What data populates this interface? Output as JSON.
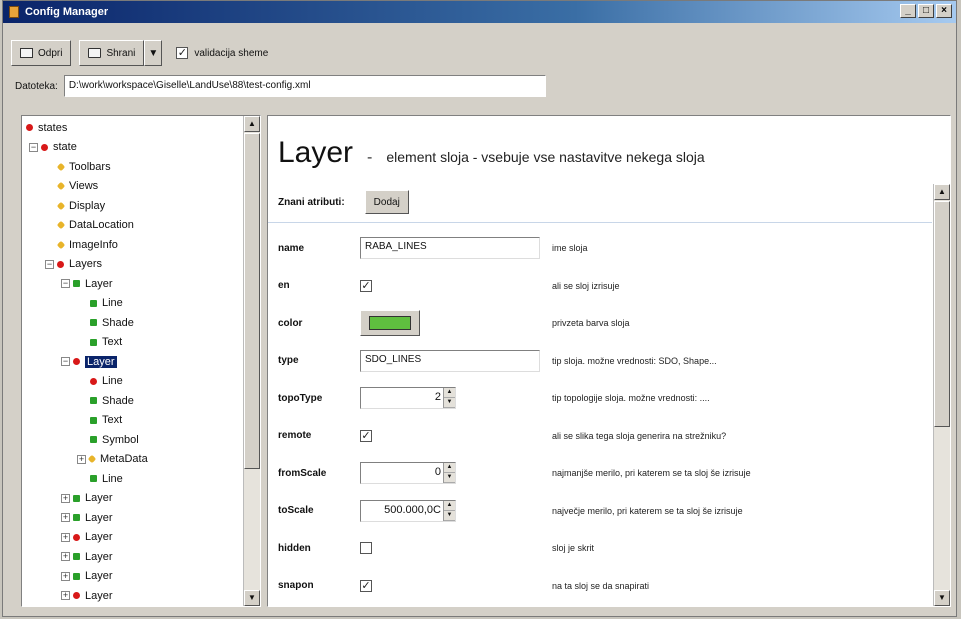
{
  "window": {
    "title": "Config Manager",
    "controls": [
      "_",
      "□",
      "×"
    ]
  },
  "toolbar": {
    "open_label": "Odpri",
    "save_label": "Shrani",
    "save_dropdown": "▼",
    "validation_label": "validacija sheme",
    "validation_checked": "✓"
  },
  "file": {
    "label": "Datoteka:",
    "path": "D:\\work\\workspace\\Giselle\\LandUse\\88\\test-config.xml"
  },
  "tree": {
    "items": [
      {
        "label": "states",
        "icon": "red",
        "level": 0,
        "expander": ""
      },
      {
        "label": "state",
        "icon": "red",
        "level": 1,
        "expander": "−"
      },
      {
        "label": "Toolbars",
        "icon": "yellow",
        "level": 2,
        "expander": ""
      },
      {
        "label": "Views",
        "icon": "yellow",
        "level": 2,
        "expander": ""
      },
      {
        "label": "Display",
        "icon": "yellow",
        "level": 2,
        "expander": ""
      },
      {
        "label": "DataLocation",
        "icon": "yellow",
        "level": 2,
        "expander": ""
      },
      {
        "label": "ImageInfo",
        "icon": "yellow",
        "level": 2,
        "expander": ""
      },
      {
        "label": "Layers",
        "icon": "red",
        "level": 2,
        "expander": "−"
      },
      {
        "label": "Layer",
        "icon": "green",
        "level": 3,
        "expander": "−"
      },
      {
        "label": "Line",
        "icon": "green",
        "level": 4,
        "expander": ""
      },
      {
        "label": "Shade",
        "icon": "green",
        "level": 4,
        "expander": ""
      },
      {
        "label": "Text",
        "icon": "green",
        "level": 4,
        "expander": ""
      },
      {
        "label": "Layer",
        "icon": "red",
        "level": 3,
        "expander": "−",
        "selected": true
      },
      {
        "label": "Line",
        "icon": "red",
        "level": 4,
        "expander": ""
      },
      {
        "label": "Shade",
        "icon": "green",
        "level": 4,
        "expander": ""
      },
      {
        "label": "Text",
        "icon": "green",
        "level": 4,
        "expander": ""
      },
      {
        "label": "Symbol",
        "icon": "green",
        "level": 4,
        "expander": ""
      },
      {
        "label": "MetaData",
        "icon": "yellow",
        "level": 4,
        "expander": "+"
      },
      {
        "label": "Line",
        "icon": "green",
        "level": 4,
        "expander": ""
      },
      {
        "label": "Layer",
        "icon": "green",
        "level": 3,
        "expander": "+"
      },
      {
        "label": "Layer",
        "icon": "green",
        "level": 3,
        "expander": "+"
      },
      {
        "label": "Layer",
        "icon": "red",
        "level": 3,
        "expander": "+"
      },
      {
        "label": "Layer",
        "icon": "green",
        "level": 3,
        "expander": "+"
      },
      {
        "label": "Layer",
        "icon": "green",
        "level": 3,
        "expander": "+"
      },
      {
        "label": "Layer",
        "icon": "red",
        "level": 3,
        "expander": "+"
      }
    ]
  },
  "detail": {
    "title": "Layer",
    "dash": "-",
    "description": "element sloja - vsebuje vse nastavitve nekega sloja",
    "known_attrs_label": "Znani atributi:",
    "add_button": "Dodaj",
    "properties": [
      {
        "name": "name",
        "kind": "text",
        "value": "RABA_LINES",
        "desc": "ime sloja"
      },
      {
        "name": "en",
        "kind": "check",
        "value": "✓",
        "desc": "ali se sloj izrisuje"
      },
      {
        "name": "color",
        "kind": "color",
        "value": "#5fbf3f",
        "desc": "privzeta barva sloja"
      },
      {
        "name": "type",
        "kind": "text",
        "value": "SDO_LINES",
        "desc": "tip sloja. možne vrednosti: SDO, Shape..."
      },
      {
        "name": "topoType",
        "kind": "spin",
        "value": "2",
        "desc": "tip topologije sloja. možne vrednosti: ...."
      },
      {
        "name": "remote",
        "kind": "check",
        "value": "✓",
        "desc": "ali se slika tega sloja generira na strežniku?"
      },
      {
        "name": "fromScale",
        "kind": "spin",
        "value": "0",
        "desc": "najmanjše merilo, pri katerem se ta sloj še izrisuje"
      },
      {
        "name": "toScale",
        "kind": "spin",
        "value": "500.000,0C",
        "desc": "največje merilo, pri katerem se ta sloj še izrisuje"
      },
      {
        "name": "hidden",
        "kind": "check",
        "value": "",
        "desc": "sloj je skrit"
      },
      {
        "name": "snapon",
        "kind": "check",
        "value": "✓",
        "desc": "na ta sloj se da snapirati"
      }
    ]
  }
}
